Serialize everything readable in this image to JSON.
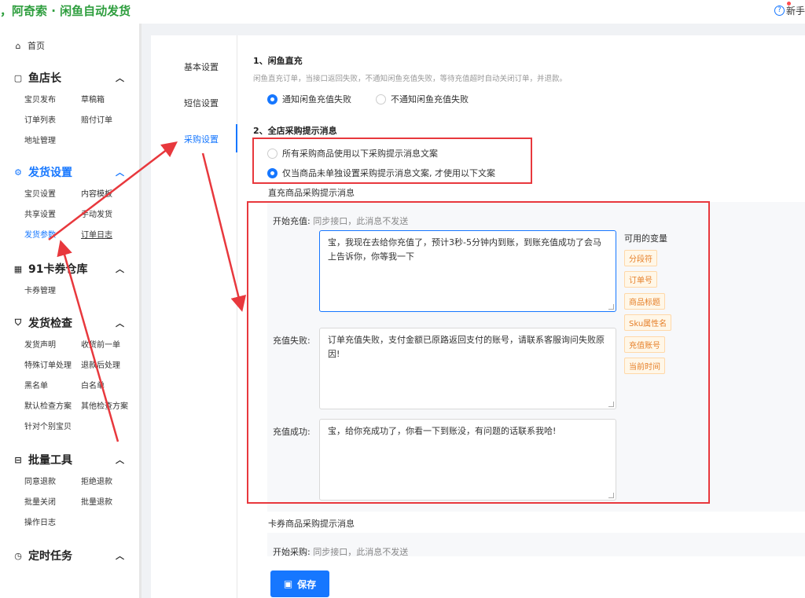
{
  "app": {
    "title": "，阿奇索 · 闲鱼自动发货",
    "help_label": "新手"
  },
  "sidebar": {
    "home": "首页",
    "groups": [
      {
        "title": "鱼店长",
        "items": [
          "宝贝发布",
          "草稿箱",
          "订单列表",
          "赔付订单",
          "地址管理"
        ]
      },
      {
        "title": "发货设置",
        "items": [
          "宝贝设置",
          "内容模板",
          "共享设置",
          "手动发货",
          "发货参数",
          "订单日志"
        ]
      },
      {
        "title": "91卡券仓库",
        "items": [
          "卡券管理"
        ]
      },
      {
        "title": "发货检查",
        "items": [
          "发货声明",
          "收货前一单",
          "特殊订单处理",
          "退款后处理",
          "黑名单",
          "白名单",
          "默认检查方案",
          "其他检查方案",
          "针对个别宝贝"
        ]
      },
      {
        "title": "批量工具",
        "items": [
          "同意退款",
          "拒绝退款",
          "批量关闭",
          "批量退款",
          "操作日志"
        ]
      },
      {
        "title": "定时任务",
        "items": []
      }
    ]
  },
  "tabs": [
    "基本设置",
    "短信设置",
    "采购设置"
  ],
  "section1": {
    "title": "1、闲鱼直充",
    "desc": "闲鱼直充订单，当接口返回失败，不通知闲鱼充值失败，等待充值超时自动关闭订单，并退款。",
    "options": [
      "通知闲鱼充值失败",
      "不通知闲鱼充值失败"
    ]
  },
  "section2": {
    "title": "2、全店采购提示消息",
    "options": [
      "所有采购商品使用以下采购提示消息文案",
      "仅当商品未单独设置采购提示消息文案, 才使用以下文案"
    ]
  },
  "direct": {
    "label": "直充商品采购提示消息",
    "start_label": "开始充值:",
    "start_hint": "同步接口，此消息不发送",
    "start_text": "宝，我现在去给你充值了，预计3秒-5分钟内到账，到账充值成功了会马上告诉你，你等我一下",
    "fail_label": "充值失败:",
    "fail_text": "订单充值失败，支付金额已原路返回支付的账号，请联系客服询问失败原因!",
    "success_label": "充值成功:",
    "success_text": "宝，给你充成功了，你看一下到账没，有问题的话联系我哈!"
  },
  "variables": {
    "title": "可用的变量",
    "items": [
      "分段符",
      "订单号",
      "商品标题",
      "Sku属性名",
      "充值账号",
      "当前时间"
    ]
  },
  "card": {
    "label": "卡券商品采购提示消息",
    "start_label": "开始采购:",
    "start_hint": "同步接口，此消息不发送"
  },
  "save_label": "保存",
  "colors": {
    "accent": "#1677ff",
    "brand_green": "#2e9e3e",
    "annotation_red": "#e8383d",
    "tag_orange": "#e6802a"
  }
}
